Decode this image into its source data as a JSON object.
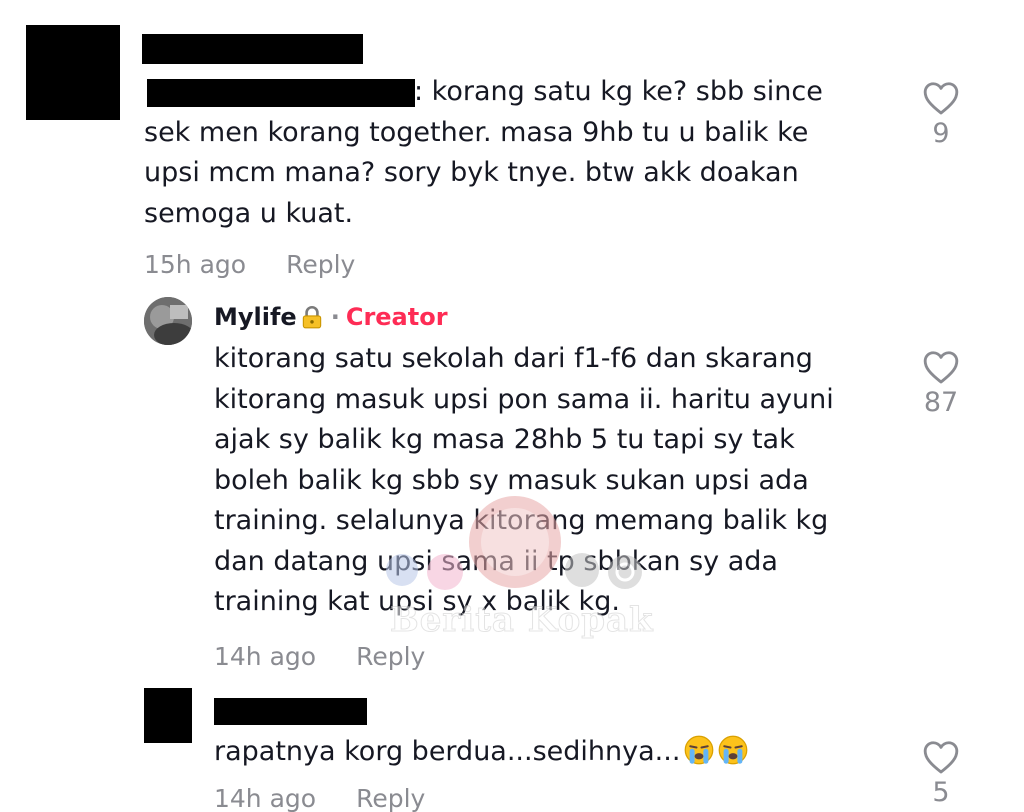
{
  "comments": [
    {
      "text": ": korang satu kg ke? sbb since\nsek men korang together. masa 9hb tu u balik ke\nupsi mcm mana? sory byk tnye. btw akk doakan\nsemoga u kuat.",
      "time": "15h ago",
      "reply_label": "Reply",
      "likes": "9"
    },
    {
      "author": "Mylife",
      "separator": "·",
      "badge": "Creator",
      "text": "kitorang satu sekolah dari f1-f6 dan skarang\nkitorang masuk upsi pon sama ii. haritu ayuni\najak sy balik kg masa 28hb 5 tu tapi sy tak\nboleh balik kg sbb sy masuk sukan upsi ada\ntraining. selalunya kitorang memang balik kg\ndan datang upsi sama ii tp sbbkan sy ada\ntraining kat upsi sy x balik kg.",
      "time": "14h ago",
      "reply_label": "Reply",
      "likes": "87"
    },
    {
      "text": "rapatnya korg berdua...sedihnya...",
      "time": "14h ago",
      "reply_label": "Reply",
      "likes": "5"
    }
  ],
  "watermark": "Berita Kopak",
  "icons": {
    "like": "heart-outline-icon",
    "lock": "lock-emoji-icon",
    "crying": "loudly-crying-face-emoji-icon"
  },
  "colors": {
    "creator_badge": "#fe2c55",
    "meta_text": "#8a8b91"
  }
}
